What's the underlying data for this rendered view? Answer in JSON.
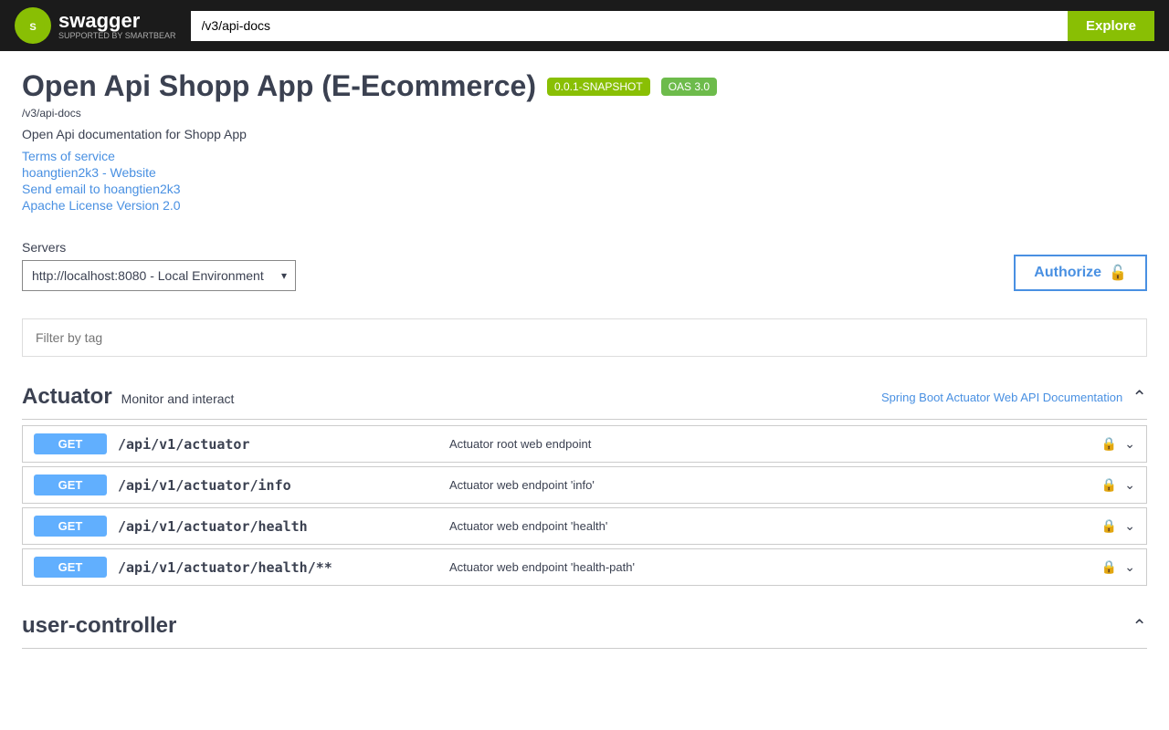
{
  "header": {
    "logo_text": "swagger",
    "logo_sub": "SUPPORTED BY SMARTBEAR",
    "search_value": "/v3/api-docs",
    "explore_label": "Explore"
  },
  "api": {
    "title": "Open Api Shopp App (E-Ecommerce)",
    "badge_snapshot": "0.0.1-SNAPSHOT",
    "badge_oas": "OAS 3.0",
    "base_url": "/v3/api-docs",
    "description": "Open Api documentation for Shopp App",
    "links": [
      {
        "label": "Terms of service",
        "href": "#"
      },
      {
        "label": "hoangtien2k3 - Website",
        "href": "#"
      },
      {
        "label": "Send email to hoangtien2k3",
        "href": "#"
      },
      {
        "label": "Apache License Version 2.0",
        "href": "#"
      }
    ]
  },
  "servers": {
    "label": "Servers",
    "options": [
      "http://localhost:8080 - Local Environment"
    ],
    "selected": "http://localhost:8080 - Local Environment"
  },
  "authorize": {
    "label": "Authorize",
    "lock_icon": "🔓"
  },
  "filter": {
    "placeholder": "Filter by tag"
  },
  "sections": [
    {
      "id": "actuator",
      "name": "Actuator",
      "desc": "Monitor and interact",
      "link": "Spring Boot Actuator Web API Documentation",
      "link_href": "#",
      "expanded": true,
      "endpoints": [
        {
          "method": "GET",
          "path": "/api/v1/actuator",
          "summary": "Actuator root web endpoint"
        },
        {
          "method": "GET",
          "path": "/api/v1/actuator/info",
          "summary": "Actuator web endpoint 'info'"
        },
        {
          "method": "GET",
          "path": "/api/v1/actuator/health",
          "summary": "Actuator web endpoint 'health'"
        },
        {
          "method": "GET",
          "path": "/api/v1/actuator/health/**",
          "summary": "Actuator web endpoint 'health-path'"
        }
      ]
    },
    {
      "id": "user-controller",
      "name": "user-controller",
      "desc": "",
      "link": "",
      "expanded": false,
      "endpoints": []
    }
  ]
}
